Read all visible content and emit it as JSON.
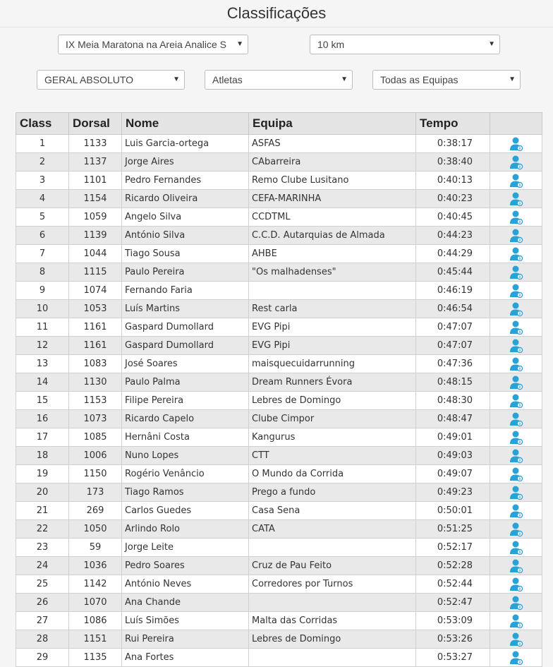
{
  "page": {
    "title": "Classificações"
  },
  "filters": {
    "event": "IX Meia Maratona na Areia Analice S",
    "distance": "10 km",
    "category": "GERAL ABSOLUTO",
    "type": "Atletas",
    "team": "Todas as Equipas"
  },
  "table": {
    "headers": [
      "Class",
      "Dorsal",
      "Nome",
      "Equipa",
      "Tempo",
      ""
    ],
    "rows": [
      [
        "1",
        "1133",
        "Luis Garcia-ortega",
        "ASFAS",
        "0:38:17"
      ],
      [
        "2",
        "1137",
        "Jorge Aires",
        "CAbarreira",
        "0:38:40"
      ],
      [
        "3",
        "1101",
        "Pedro Fernandes",
        "Remo Clube Lusitano",
        "0:40:13"
      ],
      [
        "4",
        "1154",
        "Ricardo Oliveira",
        "CEFA-MARINHA",
        "0:40:23"
      ],
      [
        "5",
        "1059",
        "Angelo Silva",
        "CCDTML",
        "0:40:45"
      ],
      [
        "6",
        "1139",
        "António Silva",
        "C.C.D. Autarquias de Almada",
        "0:44:23"
      ],
      [
        "7",
        "1044",
        "Tiago Sousa",
        "AHBE",
        "0:44:29"
      ],
      [
        "8",
        "1115",
        "Paulo Pereira",
        "\"Os malhadenses\"",
        "0:45:44"
      ],
      [
        "9",
        "1074",
        "Fernando Faria",
        "",
        "0:46:19"
      ],
      [
        "10",
        "1053",
        "Luís Martins",
        "Rest carla",
        "0:46:54"
      ],
      [
        "11",
        "1161",
        "Gaspard Dumollard",
        "EVG Pipi",
        "0:47:07"
      ],
      [
        "12",
        "1161",
        "Gaspard Dumollard",
        "EVG Pipi",
        "0:47:07"
      ],
      [
        "13",
        "1083",
        "José Soares",
        "maisquecuidarrunning",
        "0:47:36"
      ],
      [
        "14",
        "1130",
        "Paulo Palma",
        "Dream Runners Évora",
        "0:48:15"
      ],
      [
        "15",
        "1153",
        "Filipe Pereira",
        "Lebres de Domingo",
        "0:48:30"
      ],
      [
        "16",
        "1073",
        "Ricardo Capelo",
        "Clube Cimpor",
        "0:48:47"
      ],
      [
        "17",
        "1085",
        "Hernâni Costa",
        "Kangurus",
        "0:49:01"
      ],
      [
        "18",
        "1006",
        "Nuno Lopes",
        "CTT",
        "0:49:03"
      ],
      [
        "19",
        "1150",
        "Rogério Venâncio",
        "O Mundo da Corrida",
        "0:49:07"
      ],
      [
        "20",
        "173",
        "Tiago Ramos",
        "Prego a fundo",
        "0:49:23"
      ],
      [
        "21",
        "269",
        "Carlos Guedes",
        "Casa Sena",
        "0:50:01"
      ],
      [
        "22",
        "1050",
        "Arlindo Rolo",
        "CATA",
        "0:51:25"
      ],
      [
        "23",
        "59",
        "Jorge Leite",
        "",
        "0:52:17"
      ],
      [
        "24",
        "1036",
        "Pedro Soares",
        "Cruz de Pau Feito",
        "0:52:28"
      ],
      [
        "25",
        "1142",
        "António Neves",
        "Corredores por Turnos",
        "0:52:44"
      ],
      [
        "26",
        "1070",
        "Ana Chande",
        "",
        "0:52:47"
      ],
      [
        "27",
        "1086",
        "Luís Simões",
        "Malta das Corridas",
        "0:53:09"
      ],
      [
        "28",
        "1151",
        "Rui Pereira",
        "Lebres de Domingo",
        "0:53:26"
      ],
      [
        "29",
        "1135",
        "Ana Fortes",
        "",
        "0:53:27"
      ]
    ],
    "row_icon": "athlete-profile-icon"
  },
  "colors": {
    "icon_blue": "#29a3d6",
    "row_alt": "#e9e9e9",
    "header_bg": "#e4e4e4"
  }
}
